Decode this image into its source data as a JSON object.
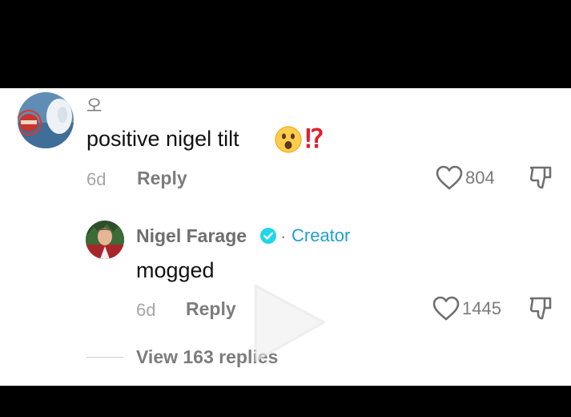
{
  "comment": {
    "username": "오",
    "text": "positive nigel tilt",
    "emoji_face": "surprised-face",
    "emoji_mark": "⁉",
    "date": "6d",
    "reply_label": "Reply",
    "likes": "804"
  },
  "reply": {
    "author": "Nigel Farage",
    "separator": "·",
    "badge": "Creator",
    "text": "mogged",
    "date": "6d",
    "reply_label": "Reply",
    "likes": "1445"
  },
  "view_replies_label": "View 163 replies",
  "colors": {
    "creator_accent": "#1f9fd1",
    "verified_badge": "#20d5ec",
    "mark_red": "#e0202f"
  },
  "icons": [
    "heart-icon",
    "dislike-icon",
    "verified-icon",
    "play-icon"
  ]
}
